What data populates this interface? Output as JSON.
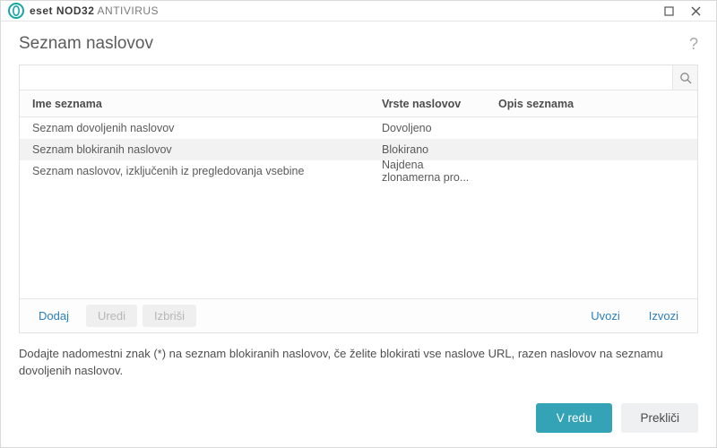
{
  "titlebar": {
    "brand_strong": "NOD32",
    "brand_light": "ANTIVIRUS"
  },
  "page": {
    "heading": "Seznam naslovov",
    "help_symbol": "?"
  },
  "search": {
    "placeholder": ""
  },
  "table": {
    "headers": {
      "name": "Ime seznama",
      "type": "Vrste naslovov",
      "desc": "Opis seznama"
    },
    "rows": [
      {
        "name": "Seznam dovoljenih naslovov",
        "type": "Dovoljeno",
        "desc": ""
      },
      {
        "name": "Seznam blokiranih naslovov",
        "type": "Blokirano",
        "desc": ""
      },
      {
        "name": "Seznam naslovov, izključenih iz pregledovanja vsebine",
        "type": "Najdena zlonamerna pro...",
        "desc": ""
      }
    ]
  },
  "actions": {
    "add": "Dodaj",
    "edit": "Uredi",
    "delete": "Izbriši",
    "import": "Uvozi",
    "export": "Izvozi"
  },
  "hint": "Dodajte nadomestni znak (*) na seznam blokiranih naslovov, če želite blokirati vse naslove URL, razen naslovov na seznamu dovoljenih naslovov.",
  "footer": {
    "ok": "V redu",
    "cancel": "Prekliči"
  }
}
